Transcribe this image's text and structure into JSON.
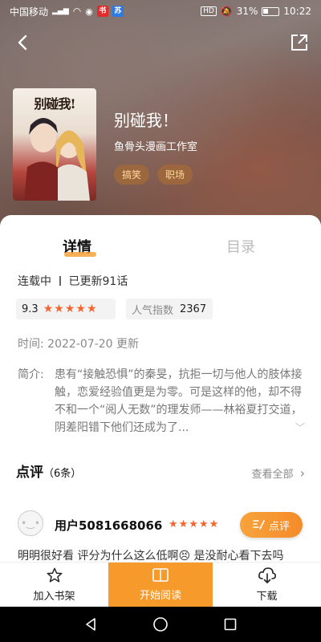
{
  "status_bar": {
    "carrier": "中国移动",
    "signal": "4G",
    "battery": "31%",
    "time": "10:22",
    "hd": "HD"
  },
  "comic": {
    "cover_title": "别碰我!",
    "title": "别碰我！",
    "author": "鱼骨头漫画工作室",
    "tags": [
      "搞笑",
      "职场"
    ]
  },
  "tabs": {
    "detail": "详情",
    "catalog": "目录"
  },
  "info": {
    "serial_status": "连载中",
    "updated": "已更新91话",
    "rating": "9.3",
    "rating_stars": 5,
    "popularity_label": "人气指数",
    "popularity_value": "2367",
    "time_label": "时间:",
    "time_value": "2022-07-20 更新",
    "intro_label": "简介:",
    "intro_text": "患有“接触恐惧”的秦旻，抗拒一切与他人的肢体接触，恋爱经验值更是为零。可是这样的他，却不得不和一个“阅人无数”的理发师——林裕夏打交道，阴差阳错下他们还成为了..."
  },
  "reviews": {
    "title": "点评",
    "count": "（6条）",
    "view_all": "查看全部",
    "comment_button": "点评",
    "items": [
      {
        "user": "用户5081668066",
        "stars": 5,
        "text": "明明很好看 评分为什么这么低啊😣 是没耐心看下去吗"
      }
    ]
  },
  "actions": {
    "add_shelf": "加入书架",
    "start_read": "开始阅读",
    "download": "下载"
  },
  "colors": {
    "accent": "#f69a2c",
    "star": "#f4652f"
  }
}
